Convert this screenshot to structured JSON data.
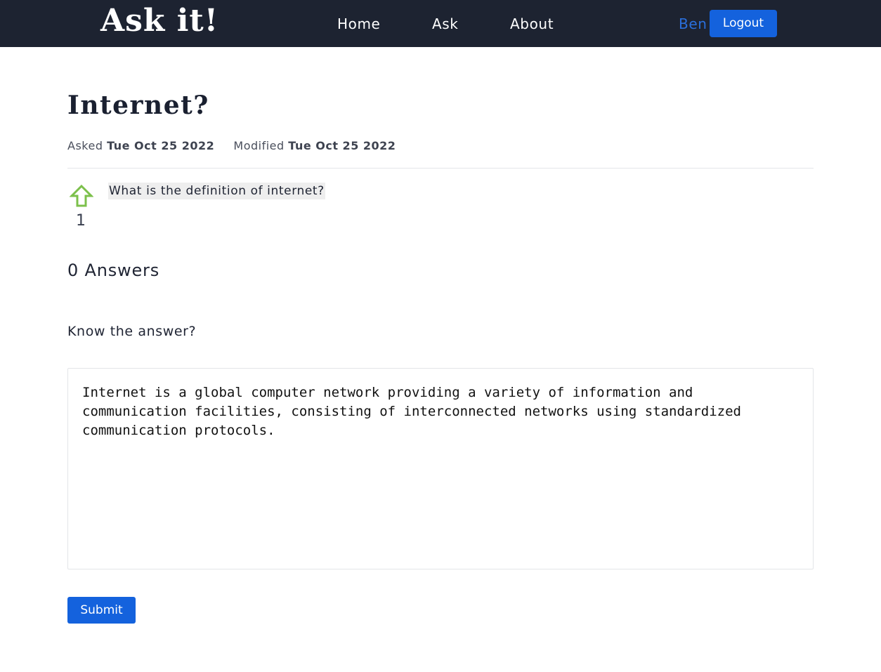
{
  "nav": {
    "brand": "Ask it!",
    "links": [
      {
        "label": "Home"
      },
      {
        "label": "Ask"
      },
      {
        "label": "About"
      }
    ],
    "username": "Ben",
    "logout_label": "Logout"
  },
  "question": {
    "title": "Internet?",
    "asked_label": "Asked",
    "asked_date": "Tue Oct 25 2022",
    "modified_label": "Modified",
    "modified_date": "Tue Oct 25 2022",
    "body": "What is the definition of internet?",
    "votes": "1",
    "upvote_icon": "arrow-up-outline-icon",
    "upvote_color": "#7cc04b"
  },
  "answers": {
    "heading": "0 Answers"
  },
  "answer_form": {
    "prompt": "Know the answer?",
    "value": "Internet is a global computer network providing a variety of information and communication facilities, consisting of interconnected networks using standardized communication protocols.",
    "submit_label": "Submit"
  },
  "colors": {
    "navbar": "#1d2331",
    "primary": "#1462dd",
    "username": "#2a6fdb"
  }
}
